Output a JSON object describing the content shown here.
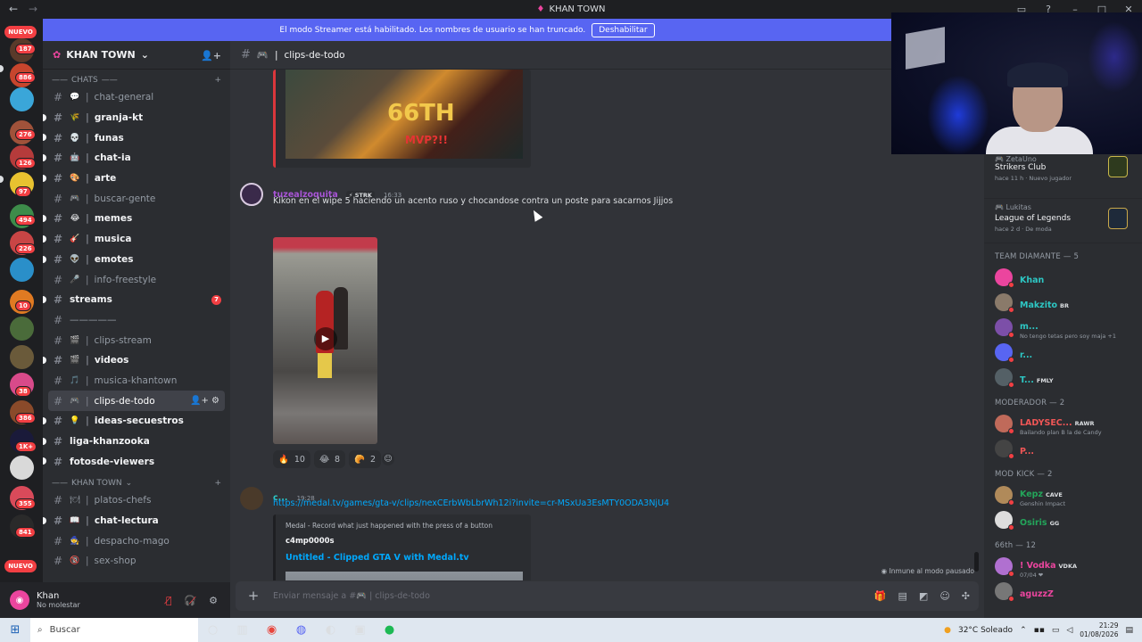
{
  "window": {
    "title": "KHAN TOWN"
  },
  "banner": {
    "text": "El modo Streamer está habilitado. Los nombres de usuario se han truncado.",
    "button": "Deshabilitar"
  },
  "server_rail": {
    "top_badge": "NUEVO",
    "bottom_badge": "NUEVO",
    "badges": [
      "187",
      "886",
      "276",
      "126",
      "97",
      "494",
      "226",
      "10",
      "38",
      "386",
      "1K+",
      "355",
      "841"
    ]
  },
  "guild": {
    "name": "KHAN TOWN"
  },
  "categories": {
    "chats": "CHATS",
    "khan_town": "KHAN TOWN"
  },
  "channels": [
    {
      "name": "chat-general",
      "emoji": "💬",
      "unread": false
    },
    {
      "name": "granja-kt",
      "emoji": "🌾",
      "unread": true
    },
    {
      "name": "funas",
      "emoji": "💀",
      "unread": true
    },
    {
      "name": "chat-ia",
      "emoji": "🤖",
      "unread": true
    },
    {
      "name": "arte",
      "emoji": "🎨",
      "unread": true
    },
    {
      "name": "buscar-gente",
      "emoji": "🎮",
      "unread": false
    },
    {
      "name": "memes",
      "emoji": "😂",
      "unread": true
    },
    {
      "name": "musica",
      "emoji": "🎸",
      "unread": true
    },
    {
      "name": "emotes",
      "emoji": "👽",
      "unread": true
    },
    {
      "name": "info-freestyle",
      "emoji": "🎤",
      "unread": false
    },
    {
      "name": "streams",
      "emoji": "",
      "unread": true,
      "badge": "7"
    },
    {
      "name": "—————",
      "emoji": "",
      "unread": false
    },
    {
      "name": "clips-stream",
      "emoji": "🎬",
      "unread": false
    },
    {
      "name": "videos",
      "emoji": "🎬",
      "unread": true
    },
    {
      "name": "musica-khantown",
      "emoji": "🎵",
      "unread": false
    },
    {
      "name": "clips-de-todo",
      "emoji": "🎮",
      "unread": false,
      "active": true
    },
    {
      "name": "ideas-secuestros",
      "emoji": "💡",
      "unread": true
    },
    {
      "name": "liga-khanzooka",
      "emoji": "",
      "unread": true
    },
    {
      "name": "fotosde-viewers",
      "emoji": "",
      "unread": true
    }
  ],
  "channels2": [
    {
      "name": "platos-chefs",
      "emoji": "🍽",
      "unread": false
    },
    {
      "name": "chat-lectura",
      "emoji": "📖",
      "unread": true
    },
    {
      "name": "despacho-mago",
      "emoji": "🧙",
      "unread": false
    },
    {
      "name": "sex-shop",
      "emoji": "🔞",
      "unread": false
    }
  ],
  "user": {
    "name": "Khan",
    "status": "No molestar"
  },
  "header": {
    "channel": "clips-de-todo"
  },
  "messages": {
    "top_embed": {
      "overlay_text": "66TH",
      "overlay_sub": "MVP?!!"
    },
    "m1": {
      "author": "tuzealzoquita",
      "tag": "STRK",
      "time": "16:33",
      "text": "Kikon en el wipe 5 haciendo un acento ruso y chocandose contra un poste para sacarnos Jijjos",
      "reactions": [
        {
          "emoji": "🔥",
          "count": "10"
        },
        {
          "emoji": "😂",
          "count": "8"
        },
        {
          "emoji": "🥐",
          "count": "2"
        }
      ]
    },
    "m2": {
      "author": "c...",
      "time": "19:28",
      "link": "https://medal.tv/games/gta-v/clips/nexCErbWbLbrWh12i?invite=cr-MSxUa3EsMTY0ODA3NjU4",
      "embed_provider": "Medal - Record what just happened with the press of a button",
      "embed_author": "c4mp0000s",
      "embed_title": "Untitled - Clipped GTA V with Medal.tv"
    }
  },
  "composer": {
    "placeholder": "Enviar mensaje a #🎮 | clips-de-todo"
  },
  "paused_note": "Inmune al modo pausado",
  "activities": [
    {
      "user": "ZetaUno",
      "game": "Strikers Club",
      "meta": "hace 11 h · Nuevo jugador"
    },
    {
      "user": "Lukitas",
      "game": "League of Legends",
      "meta": "hace 2 d · De moda"
    }
  ],
  "member_groups": [
    {
      "title": "TEAM DIAMANTE — 5",
      "members": [
        {
          "name": "Khan",
          "tag": "",
          "sub": "",
          "color": "#2dc7c4",
          "av": "#eb459e"
        },
        {
          "name": "Makzito",
          "tag": "BR",
          "sub": "",
          "color": "#2dc7c4",
          "av": "#8a7a6a"
        },
        {
          "name": "m...",
          "tag": "",
          "sub": "No tengo tetas pero soy maja +1",
          "color": "#2dc7c4",
          "av": "#7c4fa8"
        },
        {
          "name": "r...",
          "tag": "",
          "sub": "",
          "color": "#2dc7c4",
          "av": "#5865f2"
        },
        {
          "name": "T...",
          "tag": "FMLY",
          "sub": "",
          "color": "#2dc7c4",
          "av": "#546066"
        }
      ]
    },
    {
      "title": "MODERADOR — 2",
      "members": [
        {
          "name": "LADYSEC...",
          "tag": "RAWR",
          "sub": "Bailando plan B la de Candy",
          "color": "#f05656",
          "av": "#c06a5a"
        },
        {
          "name": "P...",
          "tag": "",
          "sub": "",
          "color": "#f05656",
          "av": "#444"
        }
      ]
    },
    {
      "title": "MOD KICK — 2",
      "members": [
        {
          "name": "Kepz",
          "tag": "CAVE",
          "sub": "Genshin Impact",
          "color": "#23a55a",
          "av": "#b08a5a"
        },
        {
          "name": "Osiris",
          "tag": "GG",
          "sub": "",
          "color": "#23a55a",
          "av": "#ddd"
        }
      ]
    },
    {
      "title": "66th — 12",
      "members": [
        {
          "name": "! Vodka",
          "tag": "VDKA",
          "sub": "07/04 ❤",
          "color": "#eb459e",
          "av": "#b070d0"
        },
        {
          "name": "aguzzZ",
          "tag": "",
          "sub": "",
          "color": "#eb459e",
          "av": "#777"
        }
      ]
    }
  ],
  "taskbar": {
    "search": "Buscar",
    "weather": "32°C  Soleado",
    "time": "21:29",
    "date": "01/08/2026"
  }
}
